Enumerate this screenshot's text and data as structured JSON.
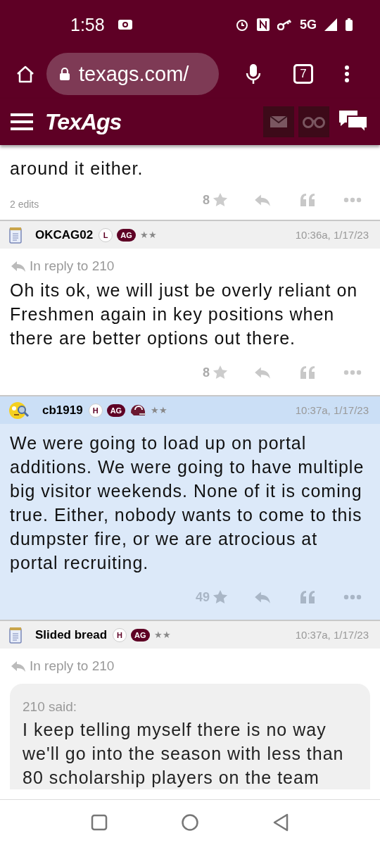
{
  "status_bar": {
    "time": "1:58",
    "network": "5G"
  },
  "browser": {
    "url": "texags.com/",
    "tab_count": "7"
  },
  "site_header": {
    "logo": "TexAgs"
  },
  "posts": [
    {
      "kind": "fragment",
      "highlighted": false,
      "body": "around it either.",
      "edits": "2 edits",
      "star_count": "8"
    },
    {
      "kind": "full",
      "highlighted": false,
      "avatar": {
        "kind": "notepad"
      },
      "username": "OKCAG02",
      "badges": [
        {
          "kind": "circle",
          "label": "L"
        },
        {
          "kind": "pill",
          "label": "AG"
        }
      ],
      "rank": "★★",
      "time": "10:36a, 1/17/23",
      "reply_to": "In reply to 210",
      "body": "Oh its ok, we will just be overly reliant on Freshmen again in key positions when there are better options out there.",
      "star_count": "8"
    },
    {
      "kind": "full",
      "highlighted": true,
      "avatar": {
        "kind": "emoji"
      },
      "username": "cb1919",
      "badges": [
        {
          "kind": "circle",
          "label": "H"
        },
        {
          "kind": "pill",
          "label": "AG"
        },
        {
          "kind": "helmet"
        }
      ],
      "rank": "★★",
      "time": "10:37a, 1/17/23",
      "body": "We were going to load up on portal additions. We were going to have multiple big visitor weekends. None of it is coming true. Either, nobody wants to come to this dumpster fire, or we are atrocious at portal recruiting.",
      "star_count": "49"
    },
    {
      "kind": "quote",
      "highlighted": false,
      "avatar": {
        "kind": "notepad"
      },
      "username": "Slided bread",
      "badges": [
        {
          "kind": "circle",
          "label": "H"
        },
        {
          "kind": "pill",
          "label": "AG"
        }
      ],
      "rank": "★★",
      "time": "10:37a, 1/17/23",
      "reply_to": "In reply to 210",
      "quote": {
        "author": "210 said:",
        "text": "I keep telling myself there is no way we'll go into the season with less than 80 scholarship players on the team"
      }
    }
  ]
}
